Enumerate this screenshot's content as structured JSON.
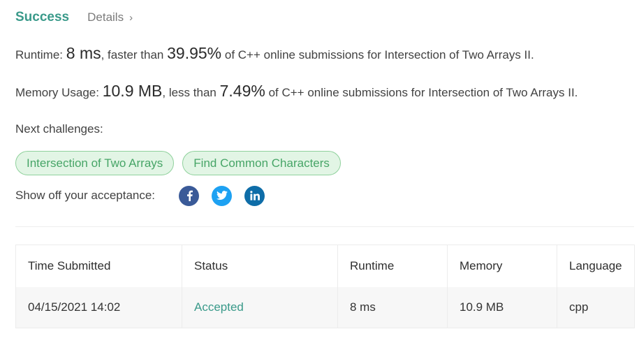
{
  "header": {
    "title": "Success",
    "details_label": "Details",
    "details_chevron": "›"
  },
  "runtime": {
    "label": "Runtime:",
    "value": "8 ms",
    "comparison": ", faster than",
    "percent": "39.95%",
    "suffix": "of C++ online submissions for Intersection of Two Arrays II."
  },
  "memory": {
    "label": "Memory Usage:",
    "value": "10.9 MB",
    "comparison": ", less than",
    "percent": "7.49%",
    "suffix": "of C++ online submissions for Intersection of Two Arrays II."
  },
  "next": {
    "label": "Next challenges:",
    "challenges": [
      "Intersection of Two Arrays",
      "Find Common Characters"
    ]
  },
  "share": {
    "label": "Show off your acceptance:",
    "icons": [
      "facebook-icon",
      "twitter-icon",
      "linkedin-icon"
    ]
  },
  "table": {
    "headers": [
      "Time Submitted",
      "Status",
      "Runtime",
      "Memory",
      "Language"
    ],
    "rows": [
      [
        "04/15/2021 14:02",
        "Accepted",
        "8 ms",
        "10.9 MB",
        "cpp"
      ]
    ]
  },
  "colors": {
    "accent": "#3a9a8a",
    "chip_bg": "#e2f5e5",
    "chip_border": "#8fd19c",
    "chip_text": "#47a567",
    "facebook": "#3a5a98",
    "twitter": "#1da1f2",
    "linkedin": "#0e6da8"
  }
}
